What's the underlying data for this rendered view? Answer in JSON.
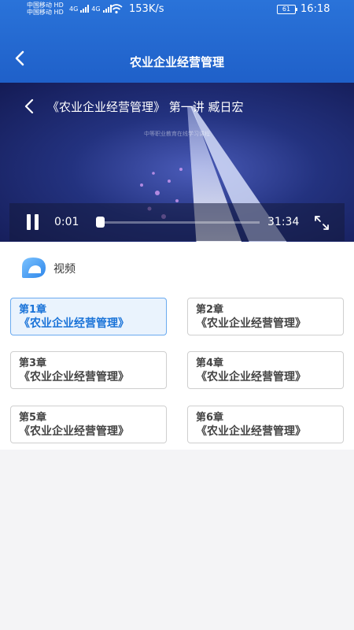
{
  "status_bar": {
    "carrier_1": "中国移动",
    "carrier_1_badge": "HD",
    "carrier_2": "中国移动",
    "carrier_2_badge": "HD",
    "network_1": "4G",
    "network_2": "4G",
    "speed": "153K/s",
    "battery": "61",
    "time": "16:18"
  },
  "navbar": {
    "title": "农业企业经营管理"
  },
  "player": {
    "title": "《农业企业经营管理》 第一讲 臧日宏",
    "watermark": "中等职业教育在线学习课程",
    "current_time": "0:01",
    "duration": "31:34",
    "progress": 0.0005
  },
  "section": {
    "label": "视频"
  },
  "chapters": [
    {
      "num": "第1章",
      "title": "《农业企业经营管理》",
      "active": true
    },
    {
      "num": "第2章",
      "title": "《农业企业经营管理》",
      "active": false
    },
    {
      "num": "第3章",
      "title": "《农业企业经营管理》",
      "active": false
    },
    {
      "num": "第4章",
      "title": "《农业企业经营管理》",
      "active": false
    },
    {
      "num": "第5章",
      "title": "《农业企业经营管理》",
      "active": false
    },
    {
      "num": "第6章",
      "title": "《农业企业经营管理》",
      "active": false
    }
  ],
  "colors": {
    "header": "#2a73d9",
    "accent": "#1a73d8",
    "active_bg": "#eaf3fd"
  }
}
